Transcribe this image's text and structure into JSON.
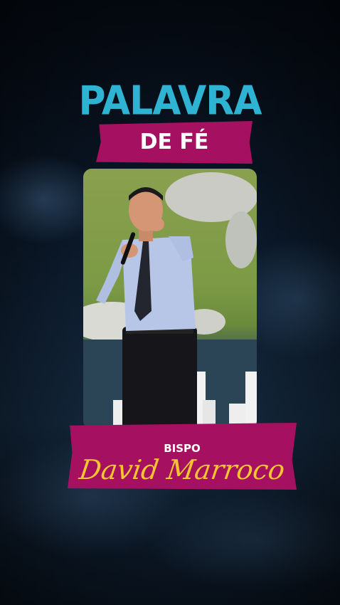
{
  "title": {
    "line1": "PALAVRA",
    "line2": "DE FÉ"
  },
  "speaker": {
    "role": "BISPO",
    "name": "David Marroco"
  },
  "colors": {
    "title_accent": "#2fb3d3",
    "banner": "#a51060",
    "name_text": "#f4c431",
    "background": "#07101c"
  }
}
